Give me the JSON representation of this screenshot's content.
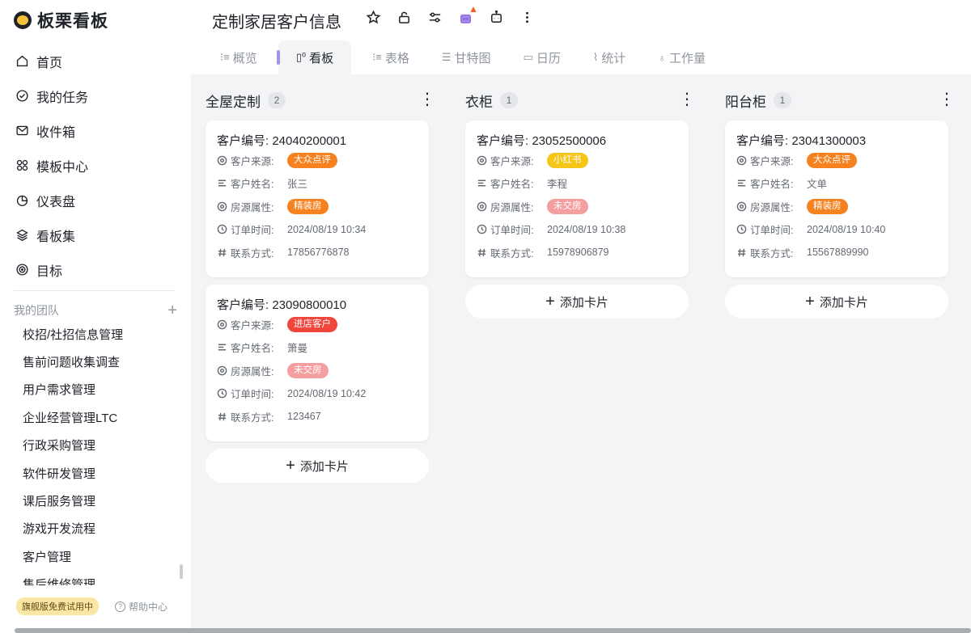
{
  "brand": {
    "name": "板栗看板"
  },
  "nav": [
    {
      "label": "首页",
      "icon": "home-icon"
    },
    {
      "label": "我的任务",
      "icon": "check-circle-icon"
    },
    {
      "label": "收件箱",
      "icon": "inbox-icon"
    },
    {
      "label": "模板中心",
      "icon": "template-icon"
    },
    {
      "label": "仪表盘",
      "icon": "dashboard-icon"
    },
    {
      "label": "看板集",
      "icon": "layers-icon"
    },
    {
      "label": "目标",
      "icon": "target-icon"
    }
  ],
  "team": {
    "header": "我的团队",
    "add": "+",
    "items": [
      "校招/社招信息管理",
      "售前问题收集调查",
      "用户需求管理",
      "企业经营管理LTC",
      "行政采购管理",
      "软件研发管理",
      "课后服务管理",
      "游戏开发流程",
      "客户管理",
      "售后维修管理"
    ]
  },
  "footer": {
    "trial": "旗舰版免费试用中",
    "help": "帮助中心",
    "help_icon": "?"
  },
  "header": {
    "title": "定制家居客户信息",
    "actions": [
      "star-icon",
      "lock-icon",
      "settings-icon",
      "plugin-icon",
      "robot-icon",
      "more-icon"
    ],
    "tabs": [
      {
        "label": "概览",
        "icon": "⁝≡"
      },
      {
        "label": "看板",
        "icon": "▯⁰"
      },
      {
        "label": "表格",
        "icon": "⁝≡"
      },
      {
        "label": "甘特图",
        "icon": "☰"
      },
      {
        "label": "日历",
        "icon": "▭"
      },
      {
        "label": "统计",
        "icon": "⌇"
      },
      {
        "label": "工作量",
        "icon": "♁"
      }
    ],
    "active_tab": "看板"
  },
  "board": {
    "field_labels": {
      "source": "客户来源:",
      "name": "客户姓名:",
      "property": "房源属性:",
      "order_time": "订单时间:",
      "contact": "联系方式:"
    },
    "add_card": "添加卡片",
    "columns": [
      {
        "title": "全屋定制",
        "count": "2",
        "cards": [
          {
            "title": "客户编号: 24040200001",
            "source": "大众点评",
            "source_color": "#f5821f",
            "name": "张三",
            "property": "精装房",
            "property_color": "#f5821f",
            "order_time": "2024/08/19 10:34",
            "contact": "17856776878"
          },
          {
            "title": "客户编号: 23090800010",
            "source": "进店客户",
            "source_color": "#f0463c",
            "name": "箫曼",
            "property": "未交房",
            "property_color": "#f59ea0",
            "order_time": "2024/08/19 10:42",
            "contact": "123467"
          }
        ]
      },
      {
        "title": "衣柜",
        "count": "1",
        "cards": [
          {
            "title": "客户编号: 23052500006",
            "source": "小红书",
            "source_color": "#f5c518",
            "name": "李程",
            "property": "未交房",
            "property_color": "#f59ea0",
            "order_time": "2024/08/19 10:38",
            "contact": "15978906879"
          }
        ]
      },
      {
        "title": "阳台柜",
        "count": "1",
        "cards": [
          {
            "title": "客户编号: 23041300003",
            "source": "大众点评",
            "source_color": "#f5821f",
            "name": "文单",
            "property": "精装房",
            "property_color": "#f5821f",
            "order_time": "2024/08/19 10:40",
            "contact": "15567889990"
          }
        ]
      }
    ]
  }
}
